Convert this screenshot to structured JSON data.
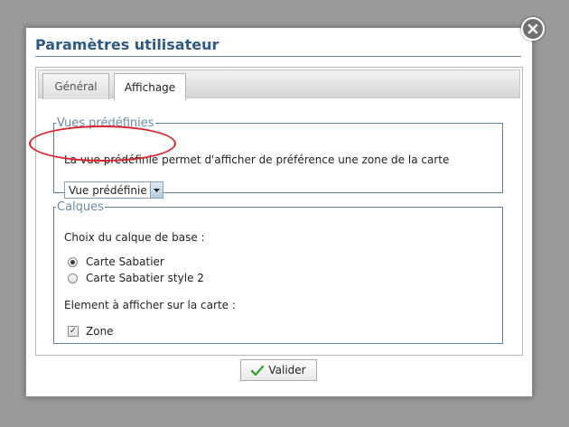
{
  "dialog": {
    "title": "Paramètres utilisateur",
    "close_icon": "close-icon",
    "tabs": [
      {
        "label": "Général",
        "active": false
      },
      {
        "label": "Affichage",
        "active": true
      }
    ]
  },
  "vues": {
    "legend": "Vues prédéfinies",
    "description": "La vue prédéfinie permet d'afficher de préférence une zone de la carte",
    "select_value": "Vue prédéfinie"
  },
  "calques": {
    "legend": "Calques",
    "base_label": "Choix du calque de base :",
    "options": [
      {
        "label": "Carte Sabatier",
        "selected": true
      },
      {
        "label": "Carte Sabatier style 2",
        "selected": false
      }
    ],
    "display_label": "Element à afficher sur la carte :",
    "checkbox": {
      "label": "Zone",
      "checked": true
    }
  },
  "footer": {
    "validate_label": "Valider",
    "validate_icon": "checkmark-icon"
  },
  "colors": {
    "title": "#2f5a86",
    "accent": "#5c86b2",
    "highlight": "#d8232a",
    "check": "#3aa23a"
  }
}
